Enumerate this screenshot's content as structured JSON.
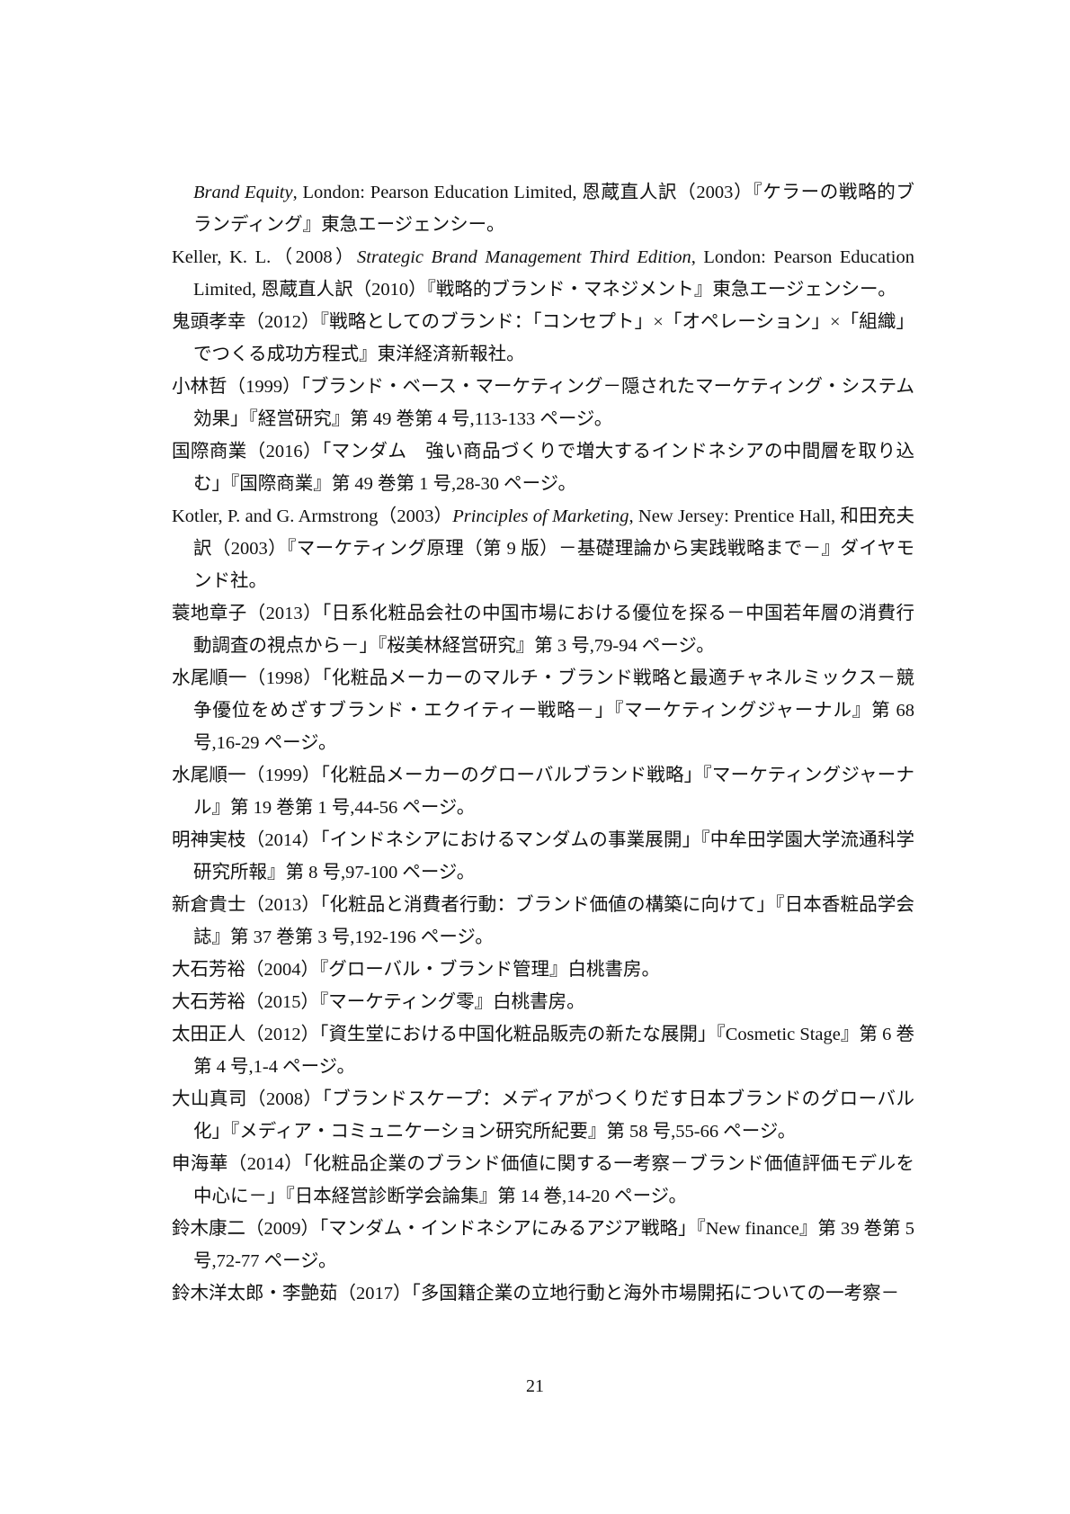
{
  "refs": [
    {
      "pre": "",
      "em": "Brand Equity",
      "post": ", London: Pearson Education Limited, 恩蔵直人訳（2003）『ケラーの戦略的ブランディング』東急エージェンシー。"
    },
    {
      "pre": "Keller, K. L.（2008）",
      "em": "Strategic Brand Management Third Edition",
      "post": ", London: Pearson Education Limited, 恩蔵直人訳（2010）『戦略的ブランド・マネジメント』東急エージェンシー。"
    },
    {
      "pre": "鬼頭孝幸（2012）『戦略としてのブランド：「コンセプト」×「オペレーション」×「組織」でつくる成功方程式』東洋経済新報社。",
      "em": "",
      "post": ""
    },
    {
      "pre": "小林哲（1999）「ブランド・ベース・マーケティング－隠されたマーケティング・システム効果」『経営研究』第 49 巻第 4 号,113-133 ページ。",
      "em": "",
      "post": ""
    },
    {
      "pre": "国際商業（2016）「マンダム　強い商品づくりで増大するインドネシアの中間層を取り込む」『国際商業』第 49 巻第 1 号,28-30 ページ。",
      "em": "",
      "post": ""
    },
    {
      "pre": "Kotler, P. and G. Armstrong（2003）",
      "em": "Principles of Marketing",
      "post": ", New Jersey: Prentice Hall, 和田充夫訳（2003）『マーケティング原理（第 9 版）－基礎理論から実践戦略まで－』ダイヤモンド社。"
    },
    {
      "pre": "蓑地章子（2013）「日系化粧品会社の中国市場における優位を探る－中国若年層の消費行動調査の視点から－」『桜美林経営研究』第 3 号,79-94 ページ。",
      "em": "",
      "post": ""
    },
    {
      "pre": "水尾順一（1998）「化粧品メーカーのマルチ・ブランド戦略と最適チャネルミックス－競争優位をめざすブランド・エクイティー戦略－」『マーケティングジャーナル』第 68 号,16-29 ページ。",
      "em": "",
      "post": ""
    },
    {
      "pre": "水尾順一（1999）「化粧品メーカーのグローバルブランド戦略」『マーケティングジャーナル』第 19 巻第 1 号,44-56 ページ。",
      "em": "",
      "post": ""
    },
    {
      "pre": "明神実枝（2014）「インドネシアにおけるマンダムの事業展開」『中牟田学園大学流通科学研究所報』第 8 号,97-100 ページ。",
      "em": "",
      "post": ""
    },
    {
      "pre": "新倉貴士（2013）「化粧品と消費者行動：ブランド価値の構築に向けて」『日本香粧品学会誌』第 37 巻第 3 号,192-196 ページ。",
      "em": "",
      "post": ""
    },
    {
      "pre": "大石芳裕（2004）『グローバル・ブランド管理』白桃書房。",
      "em": "",
      "post": ""
    },
    {
      "pre": "大石芳裕（2015）『マーケティング零』白桃書房。",
      "em": "",
      "post": ""
    },
    {
      "pre": "太田正人（2012）「資生堂における中国化粧品販売の新たな展開」『Cosmetic Stage』第 6 巻第 4 号,1-4 ページ。",
      "em": "",
      "post": ""
    },
    {
      "pre": "大山真司（2008）「ブランドスケープ：メディアがつくりだす日本ブランドのグローバル化」『メディア・コミュニケーション研究所紀要』第 58 号,55-66 ページ。",
      "em": "",
      "post": ""
    },
    {
      "pre": "申海華（2014）「化粧品企業のブランド価値に関する一考察－ブランド価値評価モデルを中心に－」『日本経営診断学会論集』第 14 巻,14-20 ページ。",
      "em": "",
      "post": ""
    },
    {
      "pre": "鈴木康二（2009）「マンダム・インドネシアにみるアジア戦略」『New finance』第 39 巻第 5 号,72-77 ページ。",
      "em": "",
      "post": ""
    },
    {
      "pre": "鈴木洋太郎・李艶茹（2017）「多国籍企業の立地行動と海外市場開拓についての一考察－",
      "em": "",
      "post": ""
    }
  ],
  "page_number": "21"
}
